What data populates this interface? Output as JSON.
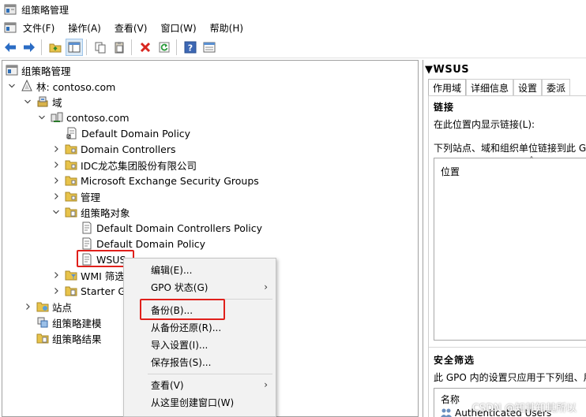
{
  "window": {
    "title": "组策略管理"
  },
  "menubar": {
    "items": [
      "文件(F)",
      "操作(A)",
      "查看(V)",
      "窗口(W)",
      "帮助(H)"
    ]
  },
  "toolbar": {
    "icons": [
      "back-arrow-icon",
      "forward-arrow-icon",
      "folder-up-icon",
      "show-hide-tree-icon",
      "copy-icon",
      "paste-icon",
      "delete-icon",
      "refresh-icon",
      "help-icon",
      "properties-icon"
    ]
  },
  "tree": {
    "root": "组策略管理",
    "forest": "林: contoso.com",
    "domains": "域",
    "domain": "contoso.com",
    "items": [
      "Default Domain Policy",
      "Domain Controllers",
      "IDC龙芯集团股份有限公司",
      "Microsoft Exchange Security Groups",
      "管理",
      "组策略对象"
    ],
    "gpos": [
      "Default Domain Controllers Policy",
      "Default Domain Policy",
      "WSUS"
    ],
    "wmi": "WMI 筛选",
    "starter": "Starter G",
    "sites": "站点",
    "modeling": "组策略建模",
    "results": "组策略结果"
  },
  "context_menu": {
    "items": [
      "编辑(E)...",
      "GPO 状态(G)",
      "备份(B)...",
      "从备份还原(R)...",
      "导入设置(I)...",
      "保存报告(S)...",
      "查看(V)",
      "从这里创建窗口(W)"
    ]
  },
  "right_pane": {
    "header": "WSUS",
    "tabs": [
      "作用域",
      "详细信息",
      "设置",
      "委派"
    ],
    "links_title": "链接",
    "links_label": "在此位置内显示链接(L):",
    "links_desc": "下列站点、域和组织单位链接到此 G",
    "location_col": "位置",
    "security_title": "安全筛选",
    "security_desc": "此 GPO 内的设置只应用于下列组、用",
    "name_col": "名称",
    "first_entry": "Authenticated Users"
  },
  "watermark": "CSDN @知其知其所以"
}
